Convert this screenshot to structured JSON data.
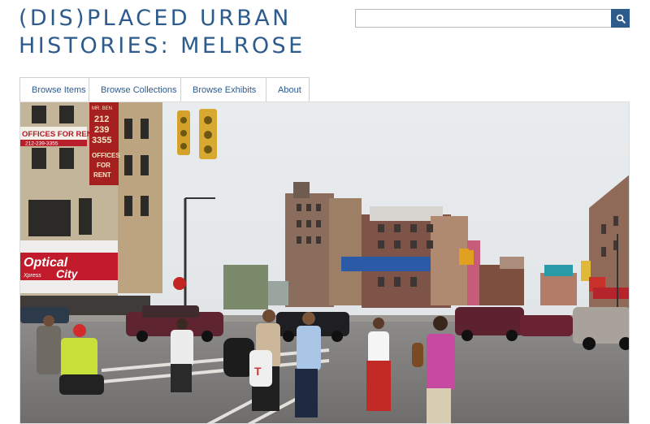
{
  "site": {
    "title_line1": "(DIS)PLACED URBAN",
    "title_line2": "HISTORIES: MELROSE",
    "accent_color": "#2d5b8c"
  },
  "search": {
    "value": "",
    "button_icon": "search-icon"
  },
  "nav": {
    "items": [
      {
        "label": "Browse Items"
      },
      {
        "label": "Browse Collections"
      },
      {
        "label": "Browse Exhibits"
      },
      {
        "label": "About"
      }
    ]
  },
  "hero": {
    "storefront_signs": {
      "offices_sign": "OFFICES FOR RENT",
      "offices_phone": "212-239-3355",
      "vertical_sign_top": "MR. BEN",
      "vertical_phone_1": "212",
      "vertical_phone_2": "239",
      "vertical_phone_3": "3355",
      "vertical_sign_bottom_1": "OFFICES",
      "vertical_sign_bottom_2": "FOR",
      "vertical_sign_bottom_3": "RENT",
      "optical_line1": "Optical",
      "optical_line2": "City",
      "optical_line3": "Xpress",
      "bag_text": "T"
    }
  }
}
